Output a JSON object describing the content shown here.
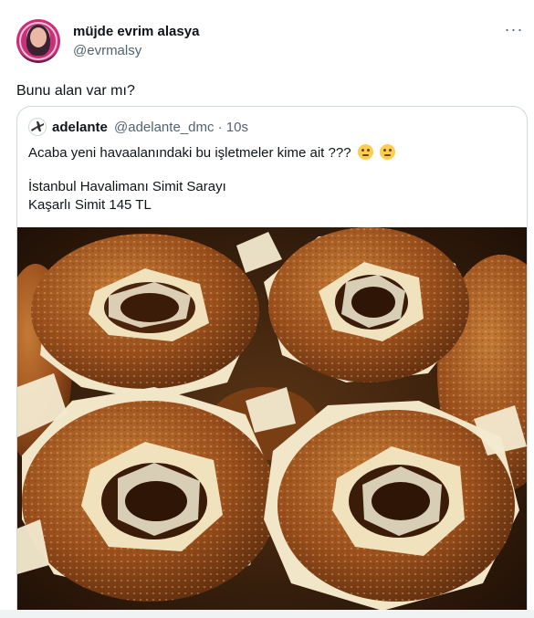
{
  "author": {
    "display_name": "müjde evrim alasya",
    "handle": "@evrmalsy"
  },
  "tweet": {
    "text": "Bunu alan var mı?"
  },
  "more_menu": {
    "glyph": "···"
  },
  "quoted_tweet": {
    "display_name": "adelante",
    "handle_time": "@adelante_dmc · 10s",
    "text_line_1": "Acaba yeni havaalanındaki bu işletmeler kime ait ???",
    "text_line_2": "İstanbul Havalimanı Simit Sarayı",
    "text_line_3": "Kaşarlı Simit 145 TL",
    "emojis": [
      "thinking-face-emoji",
      "face-with-rolling-eyes-emoji"
    ],
    "media": {
      "subject": "simit-with-cheese-photo"
    }
  },
  "colors": {
    "text_primary": "#0f1419",
    "text_secondary": "#536471",
    "border": "#cfd9de",
    "simit_crust": "#a5571f",
    "cheese": "#f3ead0"
  }
}
